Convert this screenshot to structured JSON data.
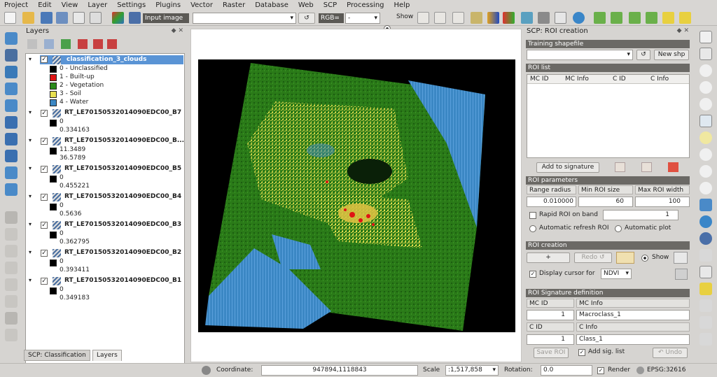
{
  "menu": [
    "Project",
    "Edit",
    "View",
    "Layer",
    "Settings",
    "Plugins",
    "Vector",
    "Raster",
    "Database",
    "Web",
    "SCP",
    "Processing",
    "Help"
  ],
  "toolbar": {
    "input_image_label": "Input image",
    "input_image_value": "",
    "refresh_glyph": "↺",
    "rgb_label": "RGB=",
    "rgb_value": "-",
    "show_label": "Show"
  },
  "layers_panel": {
    "title": "Layers",
    "tree": [
      {
        "name": "classification_3_clouds",
        "selected": true,
        "checked": true,
        "classes": [
          {
            "label": "0 - Unclassified",
            "color": "#000000"
          },
          {
            "label": "1 - Built-up",
            "color": "#e01414"
          },
          {
            "label": "2 - Vegetation",
            "color": "#2a8a1a"
          },
          {
            "label": "3 - Soil",
            "color": "#e8e050"
          },
          {
            "label": "4 - Water",
            "color": "#3b87c4"
          }
        ]
      },
      {
        "name": "RT_LE70150532014090EDC00_B7",
        "checked": true,
        "min": "0",
        "max": "0.334163"
      },
      {
        "name": "RT_LE70150532014090EDC00_B...",
        "checked": true,
        "min": "11.3489",
        "max": "36.5789"
      },
      {
        "name": "RT_LE70150532014090EDC00_B5",
        "checked": true,
        "min": "0",
        "max": "0.455221"
      },
      {
        "name": "RT_LE70150532014090EDC00_B4",
        "checked": true,
        "min": "0",
        "max": "0.5636"
      },
      {
        "name": "RT_LE70150532014090EDC00_B3",
        "checked": true,
        "min": "0",
        "max": "0.362795"
      },
      {
        "name": "RT_LE70150532014090EDC00_B2",
        "checked": true,
        "min": "0",
        "max": "0.393411"
      },
      {
        "name": "RT_LE70150532014090EDC00_B1",
        "checked": true,
        "min": "0",
        "max": "0.349183"
      }
    ],
    "tabs": [
      "SCP: Classification",
      "Layers"
    ]
  },
  "scp": {
    "title": "SCP: ROI creation",
    "training_shapefile_header": "Training shapefile",
    "training_shapefile_value": "",
    "refresh_glyph": "↺",
    "new_shp": "New shp",
    "roi_list_header": "ROI list",
    "roi_columns": [
      "MC ID",
      "MC Info",
      "C ID",
      "C Info"
    ],
    "add_to_signature": "Add to signature",
    "roi_params_header": "ROI parameters",
    "range_radius_label": "Range radius",
    "min_roi_size_label": "Min ROI size",
    "max_roi_width_label": "Max ROI width",
    "range_radius_value": "0.010000",
    "min_roi_size_value": "60",
    "max_roi_width_value": "100",
    "rapid_roi_label": "Rapid ROI on band",
    "rapid_roi_band": "1",
    "auto_refresh_label": "Automatic refresh ROI",
    "auto_plot_label": "Automatic  plot",
    "roi_creation_header": "ROI creation",
    "plus_glyph": "+",
    "redo_label": "Redo ↺",
    "show_label": "Show",
    "display_cursor_label": "Display cursor for",
    "display_cursor_value": "NDVI",
    "signature_def_header": "ROI Signature definition",
    "mc_id_label": "MC ID",
    "mc_info_label": "MC Info",
    "mc_id_value": "1",
    "mc_info_value": "Macroclass_1",
    "c_id_label": "C ID",
    "c_info_label": "C Info",
    "c_id_value": "1",
    "c_info_value": "Class_1",
    "save_roi": "Save ROI",
    "add_sig_list": "Add sig. list",
    "undo": "↶ Undo"
  },
  "status": {
    "coordinate_label": "Coordinate:",
    "coordinate_value": "947894,1118843",
    "scale_label": "Scale",
    "scale_value": ":1,517,858",
    "rotation_label": "Rotation:",
    "rotation_value": "0.0",
    "render_label": "Render",
    "epsg": "EPSG:32616"
  },
  "colors": {
    "unclassified": "#000000",
    "builtup": "#e01414",
    "vegetation": "#2a8a1a",
    "soil": "#e8e050",
    "water": "#3b87c4",
    "section_header": "#6b6965",
    "selection": "#5a94d5"
  }
}
